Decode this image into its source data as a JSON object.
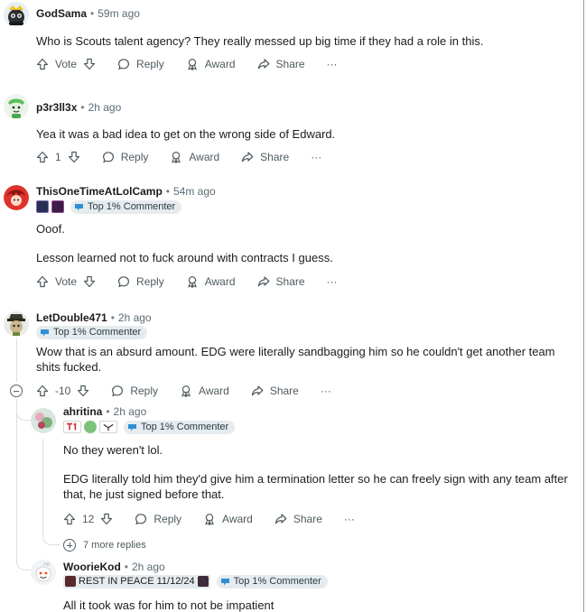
{
  "comments": [
    {
      "author": "GodSama",
      "time": "59m ago",
      "body": [
        "Who is Scouts talent agency?  They really messed up big time if they had a role in this."
      ],
      "vote": "Vote",
      "reply": "Reply",
      "award": "Award",
      "share": "Share",
      "more": "···"
    },
    {
      "author": "p3r3ll3x",
      "time": "2h ago",
      "body": [
        "Yea it was a bad idea to get on the wrong side of Edward."
      ],
      "vote": "1",
      "reply": "Reply",
      "award": "Award",
      "share": "Share",
      "more": "···"
    },
    {
      "author": "ThisOneTimeAtLolCamp",
      "time": "54m ago",
      "badge": "Top 1% Commenter",
      "body": [
        "Ooof.",
        "Lesson learned not to fuck around with contracts I guess."
      ],
      "vote": "Vote",
      "reply": "Reply",
      "award": "Award",
      "share": "Share",
      "more": "···"
    },
    {
      "author": "LetDouble471",
      "time": "2h ago",
      "badge": "Top 1% Commenter",
      "body": [
        "Wow that is an absurd amount. EDG were literally sandbagging him so he couldn't get another team shits fucked."
      ],
      "vote": "-10",
      "reply": "Reply",
      "award": "Award",
      "share": "Share",
      "more": "···"
    },
    {
      "author": "ahritina",
      "time": "2h ago",
      "badge": "Top 1% Commenter",
      "body": [
        "No they weren't lol.",
        "EDG literally told him they'd give him a termination letter so he can freely sign with any team after that, he just signed before that."
      ],
      "vote": "12",
      "reply": "Reply",
      "award": "Award",
      "share": "Share",
      "more": "···",
      "more_replies": "7 more replies"
    },
    {
      "author": "WoorieKod",
      "time": "2h ago",
      "flair_text": "REST IN PEACE 11/12/24",
      "badge": "Top 1% Commenter",
      "body": [
        "All it took was for him to not be impatient"
      ]
    }
  ]
}
